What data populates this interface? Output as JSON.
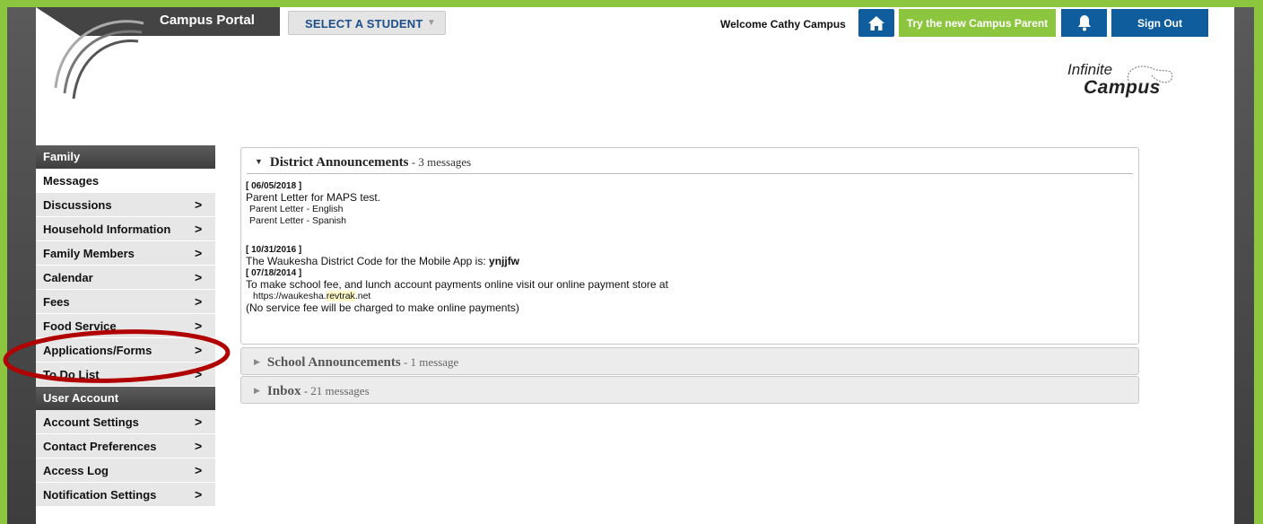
{
  "header": {
    "portal_title": "Campus Portal",
    "select_student": "SELECT A STUDENT",
    "welcome": "Welcome Cathy Campus",
    "try_new": "Try the new Campus Parent",
    "sign_out": "Sign Out"
  },
  "logo": {
    "line1": "Infinite",
    "line2": "Campus"
  },
  "sidebar": {
    "family_header": "Family",
    "family_items": [
      {
        "label": "Messages"
      },
      {
        "label": "Discussions"
      },
      {
        "label": "Household Information"
      },
      {
        "label": "Family Members"
      },
      {
        "label": "Calendar"
      },
      {
        "label": "Fees"
      },
      {
        "label": "Food Service"
      },
      {
        "label": "Applications/Forms"
      },
      {
        "label": "To Do List"
      }
    ],
    "account_header": "User Account",
    "account_items": [
      {
        "label": "Account Settings"
      },
      {
        "label": "Contact Preferences"
      },
      {
        "label": "Access Log"
      },
      {
        "label": "Notification Settings"
      }
    ],
    "chevron": ">"
  },
  "district": {
    "title": "District Announcements",
    "count": " - 3 messages",
    "messages": [
      {
        "date": "[ 06/05/2018 ]",
        "text": "Parent Letter for MAPS test.",
        "attachments": [
          "Parent Letter - English",
          "Parent Letter - Spanish"
        ]
      },
      {
        "date": "[ 10/31/2016 ]",
        "text_prefix": "The Waukesha District Code for the Mobile App is: ",
        "code": "ynjjfw"
      },
      {
        "date": "[ 07/18/2014 ]",
        "text": "To make school fee, and lunch account payments online visit our online payment store at",
        "link_a": "https://waukesha.",
        "link_b": "revtrak",
        "link_c": ".net",
        "note": "(No service fee will be charged to make online payments)"
      }
    ]
  },
  "school": {
    "title": "School Announcements",
    "count": " - 1 message"
  },
  "inbox": {
    "title": "Inbox",
    "count": " - 21 messages"
  },
  "colors": {
    "brand_green": "#8cc63f",
    "brand_blue": "#0f5d9c",
    "highlight_red": "#b00000"
  },
  "icons": {
    "home": "home-icon",
    "bell": "bell-icon",
    "expanded": "triangle-down-icon",
    "collapsed": "triangle-right-icon"
  }
}
